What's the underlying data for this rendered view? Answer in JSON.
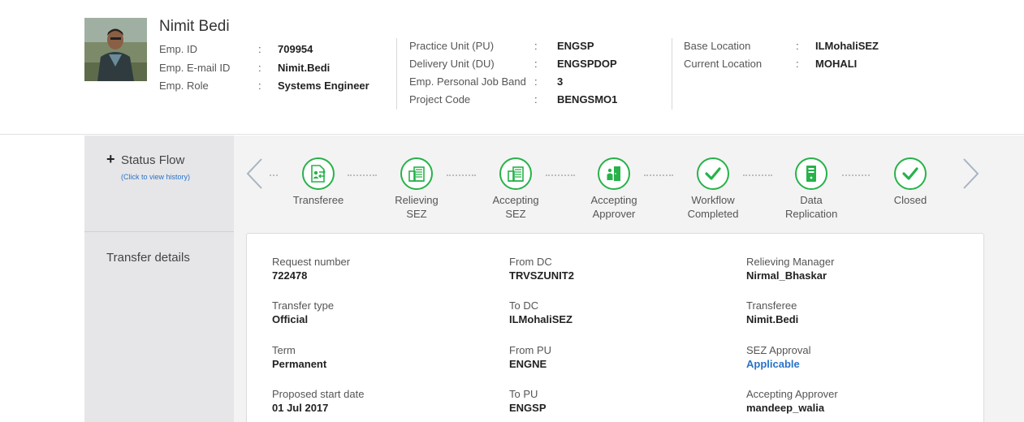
{
  "employee": {
    "name": "Nimit Bedi",
    "col1": [
      {
        "label": "Emp. ID",
        "value": "709954"
      },
      {
        "label": "Emp. E-mail ID",
        "value": "Nimit.Bedi"
      },
      {
        "label": "Emp. Role",
        "value": "Systems Engineer"
      }
    ],
    "col2": [
      {
        "label": "Practice Unit (PU)",
        "value": "ENGSP"
      },
      {
        "label": "Delivery Unit (DU)",
        "value": "ENGSPDOP"
      },
      {
        "label": "Emp. Personal Job Band",
        "value": "3"
      },
      {
        "label": "Project Code",
        "value": "BENGSMO1"
      }
    ],
    "col3": [
      {
        "label": "Base Location",
        "value": "ILMohaliSEZ"
      },
      {
        "label": "Current Location",
        "value": "MOHALI"
      }
    ],
    "separator": ":"
  },
  "rail": {
    "status_flow_label": "Status Flow",
    "status_flow_plus": "+",
    "status_flow_hint": "(Click to view history)",
    "transfer_details_label": "Transfer details"
  },
  "flow": {
    "accent_color": "#27b24a",
    "steps": [
      {
        "label": "Transferee",
        "icon": "transfer-user-icon"
      },
      {
        "label": "Relieving SEZ",
        "icon": "building-icon"
      },
      {
        "label": "Accepting SEZ",
        "icon": "building-icon"
      },
      {
        "label": "Accepting Approver",
        "icon": "door-user-icon"
      },
      {
        "label": "Workflow Completed",
        "icon": "check-icon"
      },
      {
        "label": "Data Replication",
        "icon": "server-icon"
      },
      {
        "label": "Closed",
        "icon": "check-icon"
      }
    ]
  },
  "details": [
    {
      "label": "Request number",
      "value": "722478"
    },
    {
      "label": "From DC",
      "value": "TRVSZUNIT2"
    },
    {
      "label": "Relieving Manager",
      "value": "Nirmal_Bhaskar"
    },
    {
      "label": "Transfer type",
      "value": "Official"
    },
    {
      "label": "To DC",
      "value": "ILMohaliSEZ"
    },
    {
      "label": "Transferee",
      "value": "Nimit.Bedi"
    },
    {
      "label": "Term",
      "value": "Permanent"
    },
    {
      "label": "From PU",
      "value": "ENGNE"
    },
    {
      "label": "SEZ Approval",
      "value": "Applicable"
    },
    {
      "label": "Proposed start date",
      "value": "01 Jul 2017"
    },
    {
      "label": "To PU",
      "value": "ENGSP"
    },
    {
      "label": "Accepting Approver",
      "value": "mandeep_walia"
    }
  ]
}
